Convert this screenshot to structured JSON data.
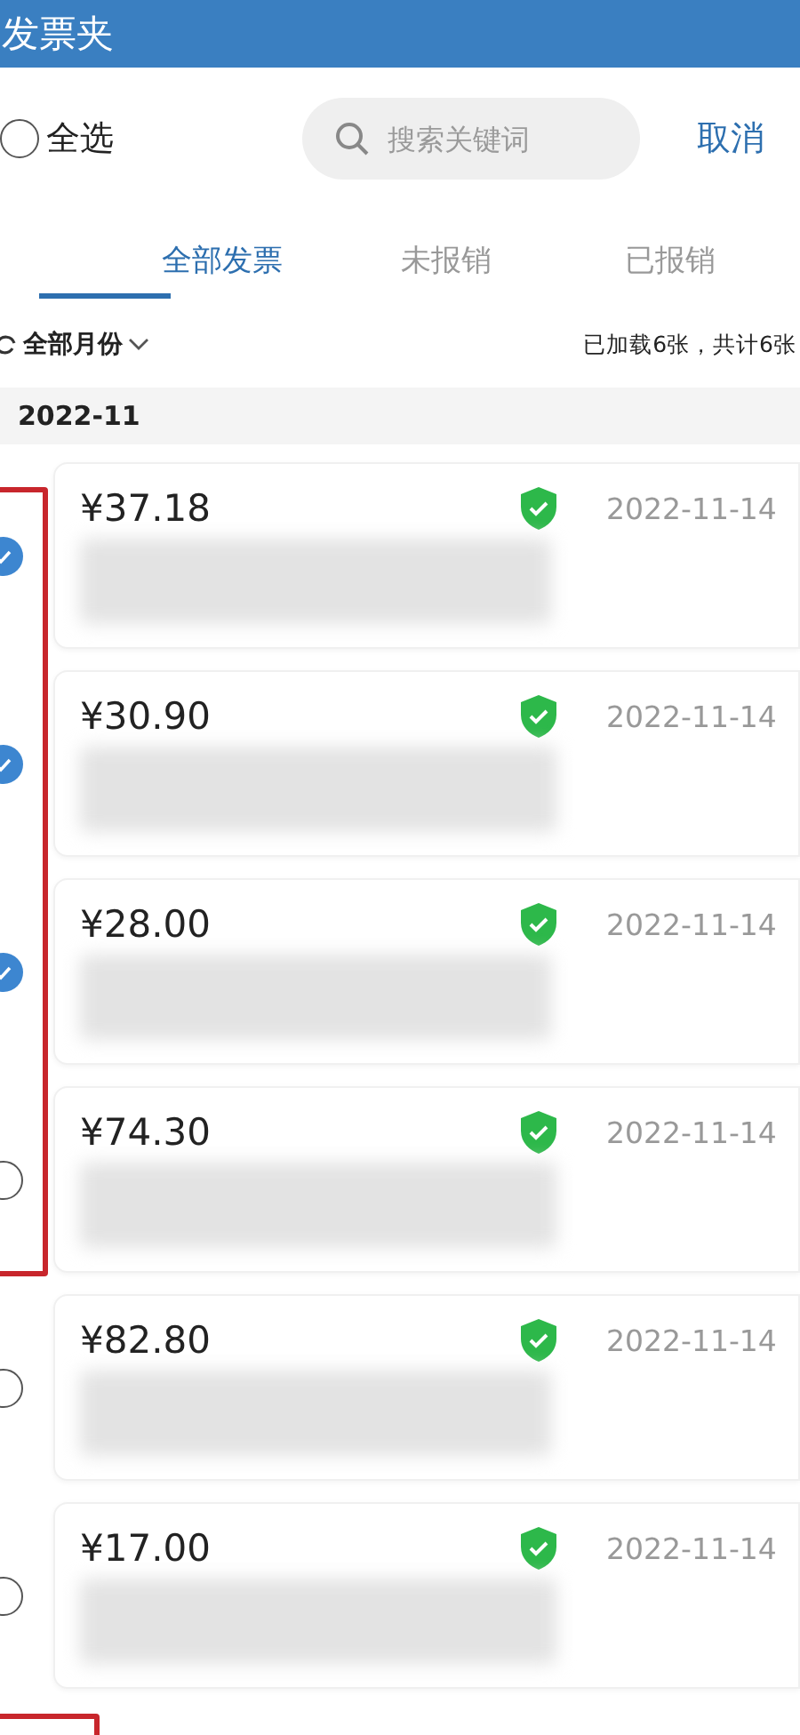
{
  "header": {
    "title": "发票夹"
  },
  "toolbar": {
    "select_all": {
      "label": "全选",
      "checked": false
    },
    "search": {
      "placeholder": "搜索关键词"
    },
    "cancel": "取消"
  },
  "tabs": [
    {
      "label": "全部发票",
      "selected": true
    },
    {
      "label": "未报销",
      "selected": false
    },
    {
      "label": "已报销",
      "selected": false
    }
  ],
  "filter": {
    "month": "全部月份",
    "summary": "已加载6张，共计6张"
  },
  "group": {
    "title": "2022-11"
  },
  "invoices": [
    {
      "amount": "¥37.18",
      "date": "2022-11-14",
      "verified": true,
      "checked": true,
      "highlighted": true
    },
    {
      "amount": "¥30.90",
      "date": "2022-11-14",
      "verified": true,
      "checked": true,
      "highlighted": true
    },
    {
      "amount": "¥28.00",
      "date": "2022-11-14",
      "verified": true,
      "checked": true,
      "highlighted": true
    },
    {
      "amount": "¥74.30",
      "date": "2022-11-14",
      "verified": true,
      "checked": false,
      "highlighted": true
    },
    {
      "amount": "¥82.80",
      "date": "2022-11-14",
      "verified": true,
      "checked": false,
      "highlighted": false
    },
    {
      "amount": "¥17.00",
      "date": "2022-11-14",
      "verified": true,
      "checked": false,
      "highlighted": false
    }
  ],
  "next_row_highlighted": true
}
